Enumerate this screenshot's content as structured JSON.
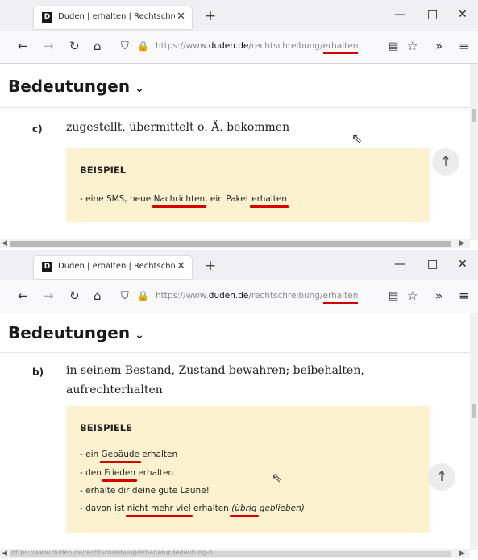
{
  "windows": [
    {
      "tab": {
        "title": "Duden | erhalten | Rechtschreib",
        "favicon": "D"
      },
      "toolbar": {
        "url_prefix": "https://www.",
        "url_domain": "duden.de",
        "url_path": "/rechtschreibung/",
        "url_word": "erhalten"
      },
      "heading": {
        "title": "Bedeutungen",
        "chevron": "⌄"
      },
      "meaning": {
        "letter": "c)",
        "text": "zugestellt, übermittelt o. Ä. bekommen"
      },
      "example": {
        "title": "BEISPIEL",
        "items": [
          {
            "parts": [
              "- eine SMS, neue ",
              "Nachrichten",
              ", ein Paket ",
              "erhalten"
            ]
          }
        ]
      }
    },
    {
      "tab": {
        "title": "Duden | erhalten | Rechtschreib",
        "favicon": "D"
      },
      "toolbar": {
        "url_prefix": "https://www.",
        "url_domain": "duden.de",
        "url_path": "/rechtschreibung/",
        "url_word": "erhalten"
      },
      "heading": {
        "title": "Bedeutungen",
        "chevron": "⌄"
      },
      "meaning": {
        "letter": "b)",
        "text": "in seinem Bestand, Zustand bewahren; beibehalten, aufrechterhalten"
      },
      "example": {
        "title": "BEISPIELE",
        "items": [
          {
            "parts": [
              "- ein ",
              "Gebäude",
              " erhalten"
            ]
          },
          {
            "parts": [
              "- den ",
              "Frieden",
              " erhalten"
            ]
          },
          {
            "parts": [
              "- erhalte dir deine gute Laune!"
            ]
          },
          {
            "parts": [
              "- davon ist ",
              "nicht mehr viel",
              " erhalten ",
              "(übrig",
              " geblieben)"
            ]
          }
        ]
      },
      "status_url": "https://www.duden.de/rechtschreibung/erhalten#Bedeutung-b"
    }
  ],
  "icons": {
    "back": "←",
    "forward": "→",
    "reload": "↻",
    "home": "⌂",
    "shield": "⛉",
    "lock": "🔒",
    "reader": "▤",
    "star": "☆",
    "overflow": "»",
    "menu": "≡",
    "minimize": "—",
    "maximize": "□",
    "close": "✕",
    "new_tab": "+",
    "scroll_top": "↑"
  },
  "colors": {
    "accent_red": "#d70000",
    "example_bg": "#fdf2d0"
  }
}
